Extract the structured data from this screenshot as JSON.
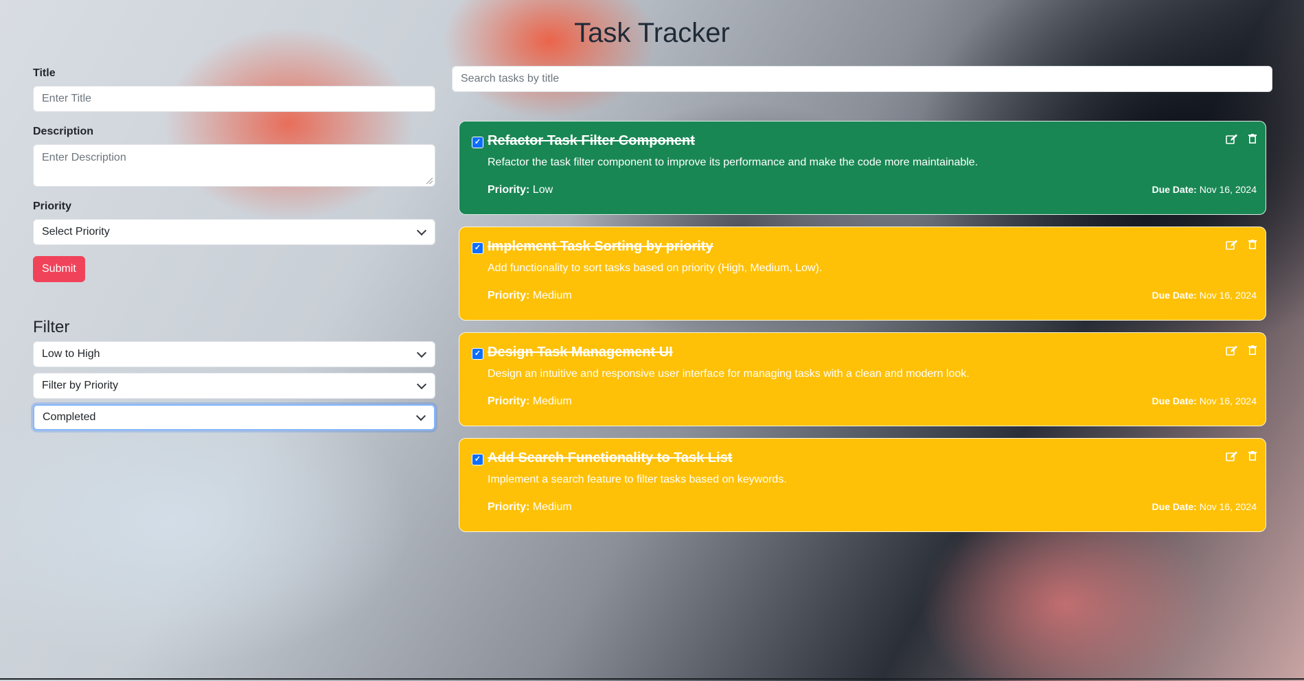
{
  "app": {
    "title": "Task Tracker"
  },
  "form": {
    "title_label": "Title",
    "title_placeholder": "Enter Title",
    "description_label": "Description",
    "description_placeholder": "Enter Description",
    "priority_label": "Priority",
    "priority_selected": "Select Priority",
    "submit_label": "Submit"
  },
  "filter": {
    "heading": "Filter",
    "sort_selected": "Low to High",
    "priority_selected": "Filter by Priority",
    "status_selected": "Completed"
  },
  "search": {
    "placeholder": "Search tasks by title"
  },
  "labels": {
    "priority": "Priority:",
    "due_date": "Due Date:"
  },
  "tasks": [
    {
      "title": "Refactor Task Filter Component",
      "description": "Refactor the task filter component to improve its performance and make the code more maintainable.",
      "priority": "Low",
      "due_date": "Nov 16, 2024",
      "completed": true,
      "color": "#198754"
    },
    {
      "title": "Implement Task Sorting by priority",
      "description": "Add functionality to sort tasks based on priority (High, Medium, Low).",
      "priority": "Medium",
      "due_date": "Nov 16, 2024",
      "completed": true,
      "color": "#ffc107"
    },
    {
      "title": "Design Task Management UI",
      "description": "Design an intuitive and responsive user interface for managing tasks with a clean and modern look.",
      "priority": "Medium",
      "due_date": "Nov 16, 2024",
      "completed": true,
      "color": "#ffc107"
    },
    {
      "title": "Add Search Functionality to Task List",
      "description": "Implement a search feature to filter tasks based on keywords.",
      "priority": "Medium",
      "due_date": "Nov 16, 2024",
      "completed": true,
      "color": "#ffc107"
    }
  ],
  "icons": {
    "checkbox": "checkbox-checked-icon",
    "edit": "edit-icon",
    "delete": "trash-icon",
    "dropdown": "chevron-down-icon"
  }
}
